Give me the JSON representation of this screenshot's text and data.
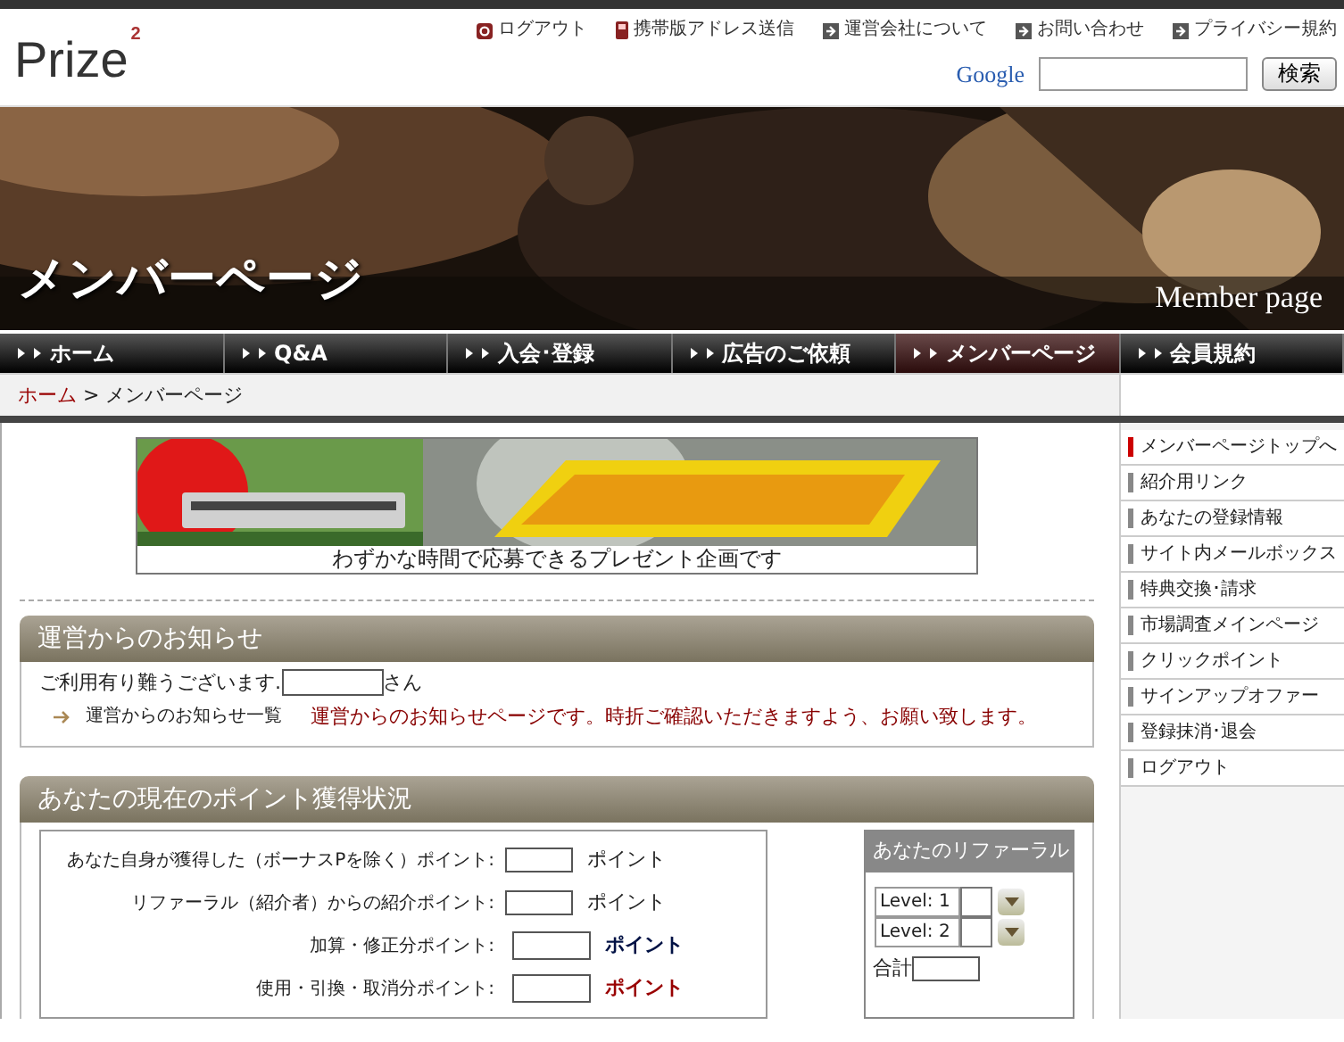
{
  "logo": {
    "text": "Prize",
    "sup": "2"
  },
  "top_links": [
    {
      "kind": "logout",
      "label": "ログアウト"
    },
    {
      "kind": "phone",
      "label": "携帯版アドレス送信"
    },
    {
      "kind": "arrow",
      "label": "運営会社について"
    },
    {
      "kind": "arrow",
      "label": "お問い合わせ"
    },
    {
      "kind": "arrow",
      "label": "プライバシー規約"
    }
  ],
  "search": {
    "brand": "Google",
    "button": "検索"
  },
  "hero": {
    "title": "メンバーページ",
    "subtitle": "Member page"
  },
  "nav": [
    {
      "label": "ホーム",
      "selected": false
    },
    {
      "label": "Q&A",
      "selected": false
    },
    {
      "label": "入会･登録",
      "selected": false
    },
    {
      "label": "広告のご依頼",
      "selected": false
    },
    {
      "label": "メンバーページ",
      "selected": true
    },
    {
      "label": "会員規約",
      "selected": false
    }
  ],
  "breadcrumb": {
    "link": "ホーム",
    "current": "> メンバーページ"
  },
  "banner": {
    "kind": "picture",
    "caption": "わずかな時間で応募できるプレゼント企画です"
  },
  "notice": {
    "title": "運営からのお知らせ",
    "greeting": "ご利用有り難うございます.",
    "suffix": "さん",
    "link": "運営からのお知らせ一覧",
    "message": "運営からのお知らせページです。時折ご確認いただきますよう、お願い致します。"
  },
  "points": {
    "title": "あなたの現在のポイント獲得状況",
    "rows": [
      {
        "label": "あなた自身が獲得した（ボーナスPを除く）ポイント:",
        "unit": "ポイント",
        "kind": "plain"
      },
      {
        "label": "リファーラル（紹介者）からの紹介ポイント:",
        "unit": "ポイント",
        "kind": "plain"
      },
      {
        "label": "加算・修正分ポイント:",
        "unit": "ポイント",
        "kind": "plus"
      },
      {
        "label": "使用・引換・取消分ポイント:",
        "unit": "ポイント",
        "kind": "minus"
      }
    ],
    "referral": {
      "title": "あなたのリファーラル",
      "levels": [
        "Level: 1",
        "Level: 2"
      ],
      "total": "合計"
    }
  },
  "sidebar": [
    {
      "label": "メンバーページトップへ",
      "selected": true
    },
    {
      "label": "紹介用リンク",
      "selected": false
    },
    {
      "label": "あなたの登録情報",
      "selected": false
    },
    {
      "label": "サイト内メールボックス",
      "selected": false
    },
    {
      "label": "特典交換･請求",
      "selected": false
    },
    {
      "label": "市場調査メインページ",
      "selected": false
    },
    {
      "label": "クリックポイント",
      "selected": false
    },
    {
      "label": "サインアップオファー",
      "selected": false
    },
    {
      "label": "登録抹消･退会",
      "selected": false
    },
    {
      "label": "ログアウト",
      "selected": false
    }
  ]
}
